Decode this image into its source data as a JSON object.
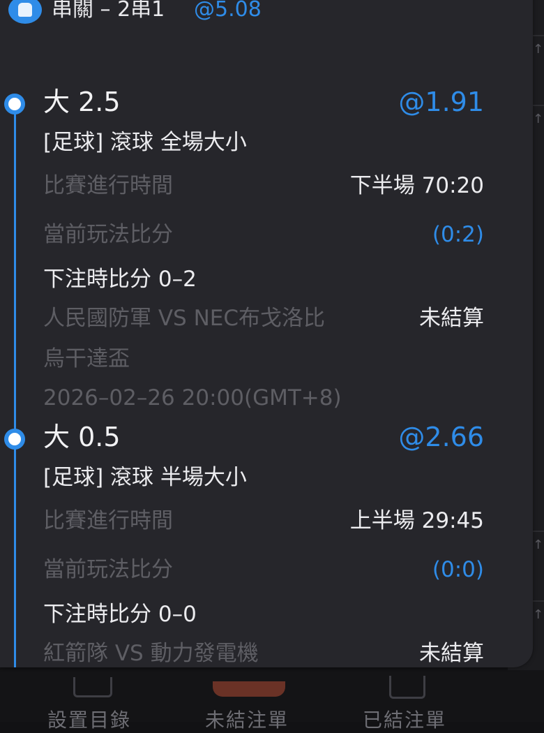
{
  "header": {
    "title": "串關 – 2串1",
    "odds": "@5.08"
  },
  "bets": [
    {
      "selection": "大 2.5",
      "odds": "@1.91",
      "market": "[足球] 滾球 全場大小",
      "match_time_label": "比賽進行時間",
      "match_time_value": "下半場 70:20",
      "current_score_label": "當前玩法比分",
      "current_score_value": "(0:2)",
      "bet_score": "下注時比分 0–2",
      "teams": "人民國防軍 VS NEC布戈洛比",
      "status": "未結算",
      "league": "烏干達盃",
      "kickoff": "2026–02–26 20:00(GMT+8)"
    },
    {
      "selection": "大 0.5",
      "odds": "@2.66",
      "market": "[足球] 滾球 半場大小",
      "match_time_label": "比賽進行時間",
      "match_time_value": "上半場 29:45",
      "current_score_label": "當前玩法比分",
      "current_score_value": "(0:0)",
      "bet_score": "下注時比分 0–0",
      "teams": "紅箭隊 VS 動力發電機",
      "status": "未結算"
    }
  ],
  "bottom_nav": {
    "items": [
      "設置目錄",
      "未結注單",
      "已結注單"
    ]
  },
  "colors": {
    "accent": "#2f8ce8",
    "sheet_bg": "#26262b",
    "dim_text": "#5e5e64"
  }
}
